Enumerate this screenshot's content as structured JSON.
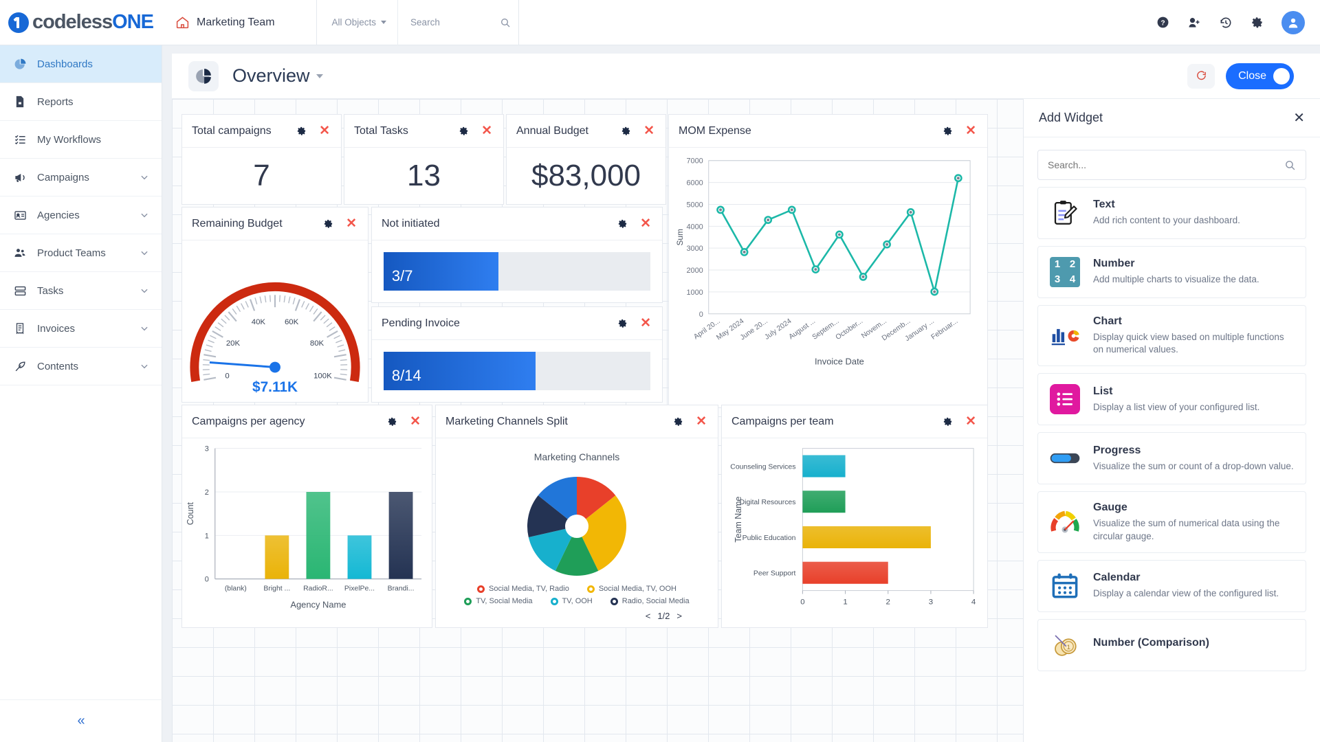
{
  "topbar": {
    "brand_grey": "codeless",
    "brand_blue": "ONE",
    "team_name": "Marketing Team",
    "all_objects_label": "All Objects",
    "search_placeholder": "Search",
    "search_value": ""
  },
  "sidebar": {
    "items": [
      {
        "label": "Dashboards",
        "icon": "pie-chart-icon",
        "active": true,
        "chevron": false
      },
      {
        "label": "Reports",
        "icon": "report-icon",
        "active": false,
        "chevron": false
      },
      {
        "label": "My Workflows",
        "icon": "checklist-icon",
        "active": false,
        "chevron": false
      },
      {
        "label": "Campaigns",
        "icon": "megaphone-icon",
        "active": false,
        "chevron": true
      },
      {
        "label": "Agencies",
        "icon": "id-card-icon",
        "active": false,
        "chevron": true
      },
      {
        "label": "Product Teams",
        "icon": "people-icon",
        "active": false,
        "chevron": true
      },
      {
        "label": "Tasks",
        "icon": "tasks-icon",
        "active": false,
        "chevron": true
      },
      {
        "label": "Invoices",
        "icon": "invoice-icon",
        "active": false,
        "chevron": true
      },
      {
        "label": "Contents",
        "icon": "leaf-icon",
        "active": false,
        "chevron": true
      }
    ],
    "collapse_label": "«"
  },
  "dashboard": {
    "title": "Overview",
    "close_label": "Close"
  },
  "widgets": {
    "total_campaigns": {
      "title": "Total campaigns",
      "value": "7"
    },
    "total_tasks": {
      "title": "Total Tasks",
      "value": "13"
    },
    "annual_budget": {
      "title": "Annual Budget",
      "value": "$83,000"
    },
    "remaining_budget": {
      "title": "Remaining Budget",
      "value": "$7.11K"
    },
    "not_initiated": {
      "title": "Not initiated",
      "value": "3/7"
    },
    "pending_invoice": {
      "title": "Pending Invoice",
      "value": "8/14"
    },
    "mom_expense": {
      "title": "MOM Expense"
    },
    "campaigns_per_agency": {
      "title": "Campaigns per agency"
    },
    "marketing_channels_split": {
      "title": "Marketing Channels Split",
      "pager": "1/2",
      "prev": "<",
      "next": ">"
    },
    "campaigns_per_team": {
      "title": "Campaigns per team"
    }
  },
  "chart_data": [
    {
      "id": "mom_expense",
      "type": "line",
      "title": "MOM Expense",
      "xlabel": "Invoice Date",
      "ylabel": "Sum",
      "ylim": [
        0,
        7000
      ],
      "yticks": [
        0,
        1000,
        2000,
        3000,
        4000,
        5000,
        6000,
        7000
      ],
      "grid": true,
      "categories": [
        "April 20...",
        "May 2024",
        "June 20...",
        "July 2024",
        "August ...",
        "Septem...",
        "October...",
        "Novem...",
        "Decemb...",
        "January ...",
        "Februar..."
      ],
      "values": [
        4750,
        2820,
        4290,
        4750,
        2030,
        3620,
        1690,
        3170,
        4640,
        1010,
        6200
      ],
      "color": "#1cb8a8",
      "legend": "none"
    },
    {
      "id": "remaining_budget",
      "type": "gauge",
      "title": "Remaining Budget",
      "value": 7110,
      "value_label": "$7.11K",
      "min": 0,
      "max": 100000,
      "tick_labels": [
        "0",
        "20K",
        "40K",
        "60K",
        "80K",
        "100K"
      ],
      "arc_color": "#cc2a10",
      "needle_color": "#1a73e8"
    },
    {
      "id": "not_initiated",
      "type": "progress",
      "title": "Not initiated",
      "value": 3,
      "total": 7,
      "label": "3/7",
      "percent": 43
    },
    {
      "id": "pending_invoice",
      "type": "progress",
      "title": "Pending Invoice",
      "value": 8,
      "total": 14,
      "label": "8/14",
      "percent": 57
    },
    {
      "id": "campaigns_per_agency",
      "type": "bar",
      "title": "Campaigns per agency",
      "xlabel": "Agency Name",
      "ylabel": "Count",
      "ylim": [
        0,
        3
      ],
      "yticks": [
        0,
        1,
        2,
        3
      ],
      "categories": [
        "(blank)",
        "Bright ...",
        "RadioR...",
        "PixelPe...",
        "Brandi..."
      ],
      "values": [
        0,
        1,
        2,
        1,
        2
      ],
      "colors": [
        "#eab308",
        "#eab308",
        "#2ab673",
        "#14b8d4",
        "#243353"
      ]
    },
    {
      "id": "marketing_channels_split",
      "type": "pie",
      "title": "Marketing Channels",
      "labels": [
        "Social Media, TV, Radio",
        "Social Media, TV, OOH",
        "TV, Social Media",
        "TV, OOH",
        "Radio, Social Media"
      ],
      "values": [
        1,
        2,
        1,
        1,
        1
      ],
      "colors": [
        "#e8402a",
        "#f2b705",
        "#1f9e58",
        "#17b0cd",
        "#243353",
        "#2176d9"
      ],
      "legend": "bottom",
      "pager": "1/2"
    },
    {
      "id": "campaigns_per_team",
      "type": "bar",
      "orientation": "horizontal",
      "title": "Campaigns per team",
      "ylabel": "Team Name",
      "xlim": [
        0,
        4
      ],
      "xticks": [
        0,
        1,
        2,
        3,
        4
      ],
      "categories": [
        "Counseling Services",
        "Digital Resources",
        "Public Education",
        "Peer Support"
      ],
      "values": [
        1,
        1,
        3,
        2
      ],
      "colors": [
        "#17b0cd",
        "#1f9e58",
        "#eab308",
        "#e8402a"
      ]
    }
  ],
  "add_widget": {
    "title": "Add Widget",
    "search_placeholder": "Search...",
    "search_value": "",
    "items": [
      {
        "name": "Text",
        "desc": "Add rich content to your dashboard.",
        "icon": "clipboard-pencil-icon"
      },
      {
        "name": "Number",
        "desc": "Add multiple charts to visualize the data.",
        "icon": "number-grid-icon",
        "digits": [
          "1",
          "2",
          "3",
          "4"
        ]
      },
      {
        "name": "Chart",
        "desc": "Display quick view based on multiple functions on numerical values.",
        "icon": "bar-donut-icon"
      },
      {
        "name": "List",
        "desc": "Display a list view of your configured list.",
        "icon": "list-icon"
      },
      {
        "name": "Progress",
        "desc": "Visualize the sum or count of a drop-down value.",
        "icon": "progress-pill-icon"
      },
      {
        "name": "Gauge",
        "desc": "Visualize the sum of numerical data using the circular gauge.",
        "icon": "gauge-icon"
      },
      {
        "name": "Calendar",
        "desc": "Display a calendar view of the configured list.",
        "icon": "calendar-icon"
      },
      {
        "name": "Number (Comparison)",
        "desc": "",
        "icon": "coins-icon"
      }
    ]
  }
}
